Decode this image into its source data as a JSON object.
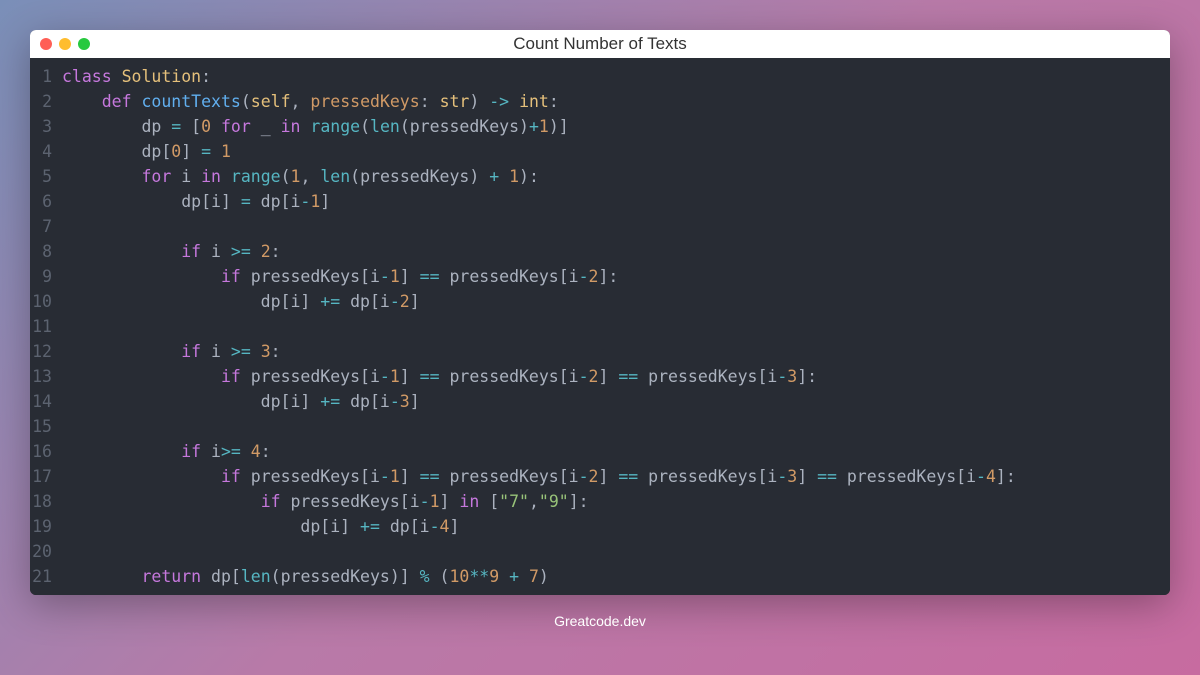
{
  "window": {
    "title": "Count Number of Texts"
  },
  "footer": {
    "text": "Greatcode.dev"
  },
  "code": {
    "lines": [
      {
        "num": "1",
        "tokens": [
          [
            "kw",
            "class"
          ],
          [
            "",
            " "
          ],
          [
            "cls",
            "Solution"
          ],
          [
            "",
            ":"
          ]
        ]
      },
      {
        "num": "2",
        "tokens": [
          [
            "",
            "    "
          ],
          [
            "kw",
            "def"
          ],
          [
            "",
            " "
          ],
          [
            "fn",
            "countTexts"
          ],
          [
            "",
            "("
          ],
          [
            "self",
            "self"
          ],
          [
            "",
            ", "
          ],
          [
            "prm",
            "pressedKeys"
          ],
          [
            "",
            ": "
          ],
          [
            "typ",
            "str"
          ],
          [
            "",
            ") "
          ],
          [
            "op",
            "->"
          ],
          [
            "",
            " "
          ],
          [
            "typ",
            "int"
          ],
          [
            "",
            ":"
          ]
        ]
      },
      {
        "num": "3",
        "tokens": [
          [
            "",
            "        dp "
          ],
          [
            "op",
            "="
          ],
          [
            "",
            " ["
          ],
          [
            "num",
            "0"
          ],
          [
            "",
            " "
          ],
          [
            "kw",
            "for"
          ],
          [
            "",
            " _ "
          ],
          [
            "kw",
            "in"
          ],
          [
            "",
            " "
          ],
          [
            "bi",
            "range"
          ],
          [
            "",
            "("
          ],
          [
            "bi",
            "len"
          ],
          [
            "",
            "(pressedKeys)"
          ],
          [
            "op",
            "+"
          ],
          [
            "num",
            "1"
          ],
          [
            "",
            ")]"
          ]
        ]
      },
      {
        "num": "4",
        "tokens": [
          [
            "",
            "        dp["
          ],
          [
            "num",
            "0"
          ],
          [
            "",
            "] "
          ],
          [
            "op",
            "="
          ],
          [
            "",
            " "
          ],
          [
            "num",
            "1"
          ]
        ]
      },
      {
        "num": "5",
        "tokens": [
          [
            "",
            "        "
          ],
          [
            "kw",
            "for"
          ],
          [
            "",
            " i "
          ],
          [
            "kw",
            "in"
          ],
          [
            "",
            " "
          ],
          [
            "bi",
            "range"
          ],
          [
            "",
            "("
          ],
          [
            "num",
            "1"
          ],
          [
            "",
            ", "
          ],
          [
            "bi",
            "len"
          ],
          [
            "",
            "(pressedKeys) "
          ],
          [
            "op",
            "+"
          ],
          [
            "",
            " "
          ],
          [
            "num",
            "1"
          ],
          [
            "",
            "):"
          ]
        ]
      },
      {
        "num": "6",
        "tokens": [
          [
            "",
            "            dp[i] "
          ],
          [
            "op",
            "="
          ],
          [
            "",
            " dp[i"
          ],
          [
            "op",
            "-"
          ],
          [
            "num",
            "1"
          ],
          [
            "",
            "]"
          ]
        ]
      },
      {
        "num": "7",
        "tokens": [
          [
            "",
            ""
          ]
        ]
      },
      {
        "num": "8",
        "tokens": [
          [
            "",
            "            "
          ],
          [
            "kw",
            "if"
          ],
          [
            "",
            " i "
          ],
          [
            "op",
            ">="
          ],
          [
            "",
            " "
          ],
          [
            "num",
            "2"
          ],
          [
            "",
            ":"
          ]
        ]
      },
      {
        "num": "9",
        "tokens": [
          [
            "",
            "                "
          ],
          [
            "kw",
            "if"
          ],
          [
            "",
            " pressedKeys[i"
          ],
          [
            "op",
            "-"
          ],
          [
            "num",
            "1"
          ],
          [
            "",
            "] "
          ],
          [
            "op",
            "=="
          ],
          [
            "",
            " pressedKeys[i"
          ],
          [
            "op",
            "-"
          ],
          [
            "num",
            "2"
          ],
          [
            "",
            "]:"
          ]
        ]
      },
      {
        "num": "10",
        "tokens": [
          [
            "",
            "                    dp[i] "
          ],
          [
            "op",
            "+="
          ],
          [
            "",
            " dp[i"
          ],
          [
            "op",
            "-"
          ],
          [
            "num",
            "2"
          ],
          [
            "",
            "]"
          ]
        ]
      },
      {
        "num": "11",
        "tokens": [
          [
            "",
            ""
          ]
        ]
      },
      {
        "num": "12",
        "tokens": [
          [
            "",
            "            "
          ],
          [
            "kw",
            "if"
          ],
          [
            "",
            " i "
          ],
          [
            "op",
            ">="
          ],
          [
            "",
            " "
          ],
          [
            "num",
            "3"
          ],
          [
            "",
            ":"
          ]
        ]
      },
      {
        "num": "13",
        "tokens": [
          [
            "",
            "                "
          ],
          [
            "kw",
            "if"
          ],
          [
            "",
            " pressedKeys[i"
          ],
          [
            "op",
            "-"
          ],
          [
            "num",
            "1"
          ],
          [
            "",
            "] "
          ],
          [
            "op",
            "=="
          ],
          [
            "",
            " pressedKeys[i"
          ],
          [
            "op",
            "-"
          ],
          [
            "num",
            "2"
          ],
          [
            "",
            "] "
          ],
          [
            "op",
            "=="
          ],
          [
            "",
            " pressedKeys[i"
          ],
          [
            "op",
            "-"
          ],
          [
            "num",
            "3"
          ],
          [
            "",
            "]:"
          ]
        ]
      },
      {
        "num": "14",
        "tokens": [
          [
            "",
            "                    dp[i] "
          ],
          [
            "op",
            "+="
          ],
          [
            "",
            " dp[i"
          ],
          [
            "op",
            "-"
          ],
          [
            "num",
            "3"
          ],
          [
            "",
            "]"
          ]
        ]
      },
      {
        "num": "15",
        "tokens": [
          [
            "",
            ""
          ]
        ]
      },
      {
        "num": "16",
        "tokens": [
          [
            "",
            "            "
          ],
          [
            "kw",
            "if"
          ],
          [
            "",
            " i"
          ],
          [
            "op",
            ">="
          ],
          [
            "",
            " "
          ],
          [
            "num",
            "4"
          ],
          [
            "",
            ":"
          ]
        ]
      },
      {
        "num": "17",
        "tokens": [
          [
            "",
            "                "
          ],
          [
            "kw",
            "if"
          ],
          [
            "",
            " pressedKeys[i"
          ],
          [
            "op",
            "-"
          ],
          [
            "num",
            "1"
          ],
          [
            "",
            "] "
          ],
          [
            "op",
            "=="
          ],
          [
            "",
            " pressedKeys[i"
          ],
          [
            "op",
            "-"
          ],
          [
            "num",
            "2"
          ],
          [
            "",
            "] "
          ],
          [
            "op",
            "=="
          ],
          [
            "",
            " pressedKeys[i"
          ],
          [
            "op",
            "-"
          ],
          [
            "num",
            "3"
          ],
          [
            "",
            "] "
          ],
          [
            "op",
            "=="
          ],
          [
            "",
            " pressedKeys[i"
          ],
          [
            "op",
            "-"
          ],
          [
            "num",
            "4"
          ],
          [
            "",
            "]:"
          ]
        ]
      },
      {
        "num": "18",
        "tokens": [
          [
            "",
            "                    "
          ],
          [
            "kw",
            "if"
          ],
          [
            "",
            " pressedKeys[i"
          ],
          [
            "op",
            "-"
          ],
          [
            "num",
            "1"
          ],
          [
            "",
            "] "
          ],
          [
            "kw",
            "in"
          ],
          [
            "",
            " ["
          ],
          [
            "str",
            "\"7\""
          ],
          [
            "",
            ","
          ],
          [
            "str",
            "\"9\""
          ],
          [
            "",
            "]:"
          ]
        ]
      },
      {
        "num": "19",
        "tokens": [
          [
            "",
            "                        dp[i] "
          ],
          [
            "op",
            "+="
          ],
          [
            "",
            " dp[i"
          ],
          [
            "op",
            "-"
          ],
          [
            "num",
            "4"
          ],
          [
            "",
            "]"
          ]
        ]
      },
      {
        "num": "20",
        "tokens": [
          [
            "",
            ""
          ]
        ]
      },
      {
        "num": "21",
        "tokens": [
          [
            "",
            "        "
          ],
          [
            "kw",
            "return"
          ],
          [
            "",
            " dp["
          ],
          [
            "bi",
            "len"
          ],
          [
            "",
            "(pressedKeys)] "
          ],
          [
            "op",
            "%"
          ],
          [
            "",
            " ("
          ],
          [
            "num",
            "10"
          ],
          [
            "op",
            "**"
          ],
          [
            "num",
            "9"
          ],
          [
            "",
            " "
          ],
          [
            "op",
            "+"
          ],
          [
            "",
            " "
          ],
          [
            "num",
            "7"
          ],
          [
            "",
            ")"
          ]
        ]
      }
    ]
  }
}
